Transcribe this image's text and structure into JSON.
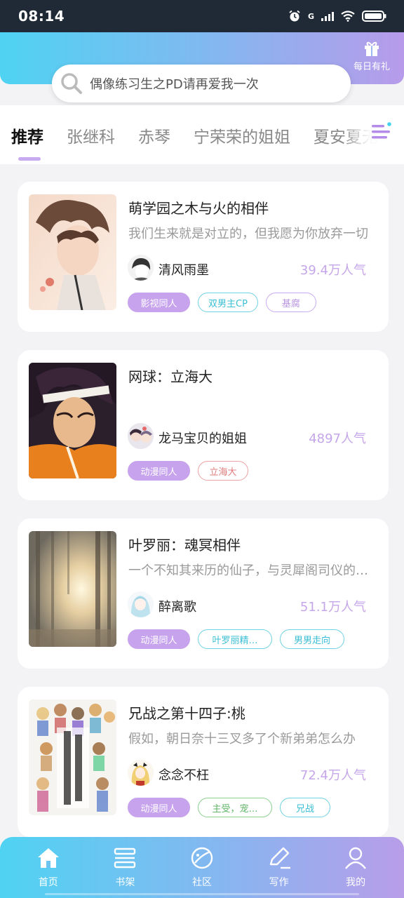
{
  "status_bar": {
    "time": "08:14",
    "network": "G"
  },
  "gift": {
    "label": "每日有礼",
    "icon": "gift-icon"
  },
  "search": {
    "placeholder": "偶像练习生之PD请再爱我一次"
  },
  "tabs": [
    {
      "label": "推荐",
      "active": true
    },
    {
      "label": "张继科"
    },
    {
      "label": "赤琴"
    },
    {
      "label": "宁荣荣的姐姐"
    },
    {
      "label": "夏安夏无"
    }
  ],
  "cards": [
    {
      "title": "萌学园之木与火的相伴",
      "desc": "我们生来就是对立的，但我愿为你放弃一切",
      "author": "清风雨墨",
      "popularity": "39.4万人气",
      "tags": [
        {
          "label": "影视同人",
          "style": "filled"
        },
        {
          "label": "双男主CP",
          "style": "cyan"
        },
        {
          "label": "基腐",
          "style": "lav"
        }
      ]
    },
    {
      "title": "网球：立海大",
      "desc": "",
      "author": "龙马宝贝的姐姐",
      "popularity": "4897人气",
      "tags": [
        {
          "label": "动漫同人",
          "style": "filled"
        },
        {
          "label": "立海大",
          "style": "red"
        }
      ]
    },
    {
      "title": "叶罗丽：魂冥相伴",
      "desc": "一个不知其来历的仙子，与灵犀阁司仪的故事",
      "author": "醉离歌",
      "popularity": "51.1万人气",
      "tags": [
        {
          "label": "动漫同人",
          "style": "filled"
        },
        {
          "label": "叶罗丽精…",
          "style": "cyan"
        },
        {
          "label": "男男走向",
          "style": "cyan"
        }
      ]
    },
    {
      "title": "兄战之第十四子:桃",
      "desc": "假如，朝日奈十三叉多了个新弟弟怎么办",
      "author": "念念不枉",
      "popularity": "72.4万人气",
      "tags": [
        {
          "label": "动漫同人",
          "style": "filled"
        },
        {
          "label": "主受，宠…",
          "style": "green"
        },
        {
          "label": "兄战",
          "style": "cyan"
        }
      ]
    }
  ],
  "bottom_nav": [
    {
      "label": "首页",
      "icon": "home-icon"
    },
    {
      "label": "书架",
      "icon": "bookshelf-icon"
    },
    {
      "label": "社区",
      "icon": "planet-icon"
    },
    {
      "label": "写作",
      "icon": "pen-icon"
    },
    {
      "label": "我的",
      "icon": "user-icon"
    }
  ],
  "colors": {
    "accent": "#c6a3ec",
    "header_start": "#4fd3f2",
    "header_end": "#b79bea"
  }
}
